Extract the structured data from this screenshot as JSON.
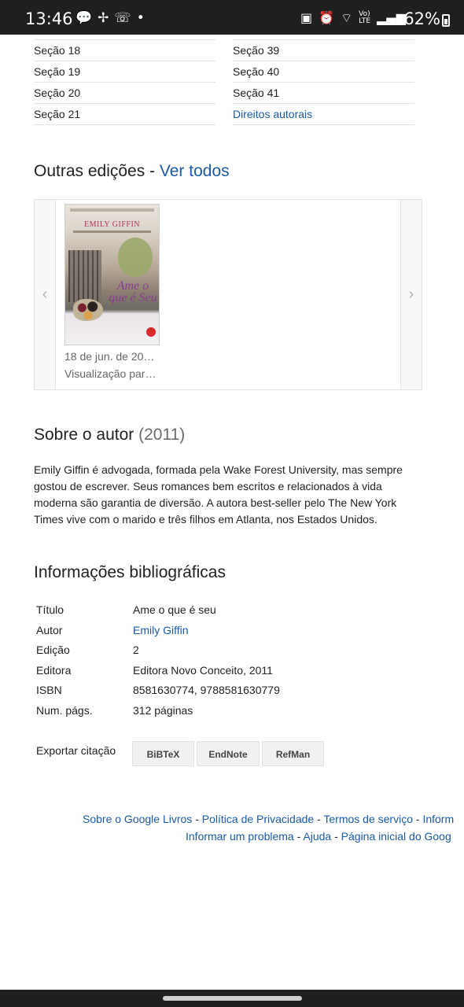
{
  "status_bar": {
    "time": "13:46",
    "left_icons": [
      "chat-bubble-icon",
      "pinwheel-icon",
      "missed-call-icon",
      "dot-icon"
    ],
    "right_icons": [
      "bag-icon",
      "alarm-icon",
      "wifi-icon",
      "volte-icon",
      "signal-icon"
    ],
    "battery": "62%"
  },
  "sections": {
    "left": [
      "Seção 18",
      "Seção 19",
      "Seção 20",
      "Seção 21"
    ],
    "right": [
      "Seção 39",
      "Seção 40",
      "Seção 41",
      "Direitos autorais"
    ]
  },
  "other_editions": {
    "title": "Outras edições - ",
    "see_all": "Ver todos",
    "prev_arrow": "‹",
    "next_arrow": "›",
    "items": [
      {
        "cover_author": "EMILY GIFFIN",
        "cover_title": "Ame o que é Seu",
        "date": "18 de jun. de 20…",
        "preview": "Visualização par…"
      }
    ]
  },
  "about_author": {
    "title": "Sobre o autor ",
    "year": "(2011)",
    "text": "Emily Giffin é advogada, formada pela Wake Forest University, mas sempre gostou de escrever. Seus romances bem escritos e relacionados à vida moderna são garantia de diversão. A autora best-seller pelo The New York Times vive com o marido e três filhos em Atlanta, nos Estados Unidos."
  },
  "bibliographic": {
    "title": "Informações bibliográficas",
    "rows": [
      {
        "key": "Título",
        "value": "Ame o que é seu"
      },
      {
        "key": "Autor",
        "value": "Emily Giffin"
      },
      {
        "key": "Edição",
        "value": "2"
      },
      {
        "key": "Editora",
        "value": "Editora Novo Conceito, 2011"
      },
      {
        "key": "ISBN",
        "value": "8581630774, 9788581630779"
      },
      {
        "key": "Num. págs.",
        "value": "312 páginas"
      }
    ],
    "export_label": "Exportar citação",
    "export_buttons": [
      "BiBTeX",
      "EndNote",
      "RefMan"
    ]
  },
  "footer": {
    "line1": [
      "Sobre o Google Livros",
      "Política de Privacidade",
      "Termos de serviço",
      "Inform"
    ],
    "line2": [
      "Informar um problema",
      "Ajuda",
      "Página inicial do Goog"
    ],
    "separator": " - "
  }
}
